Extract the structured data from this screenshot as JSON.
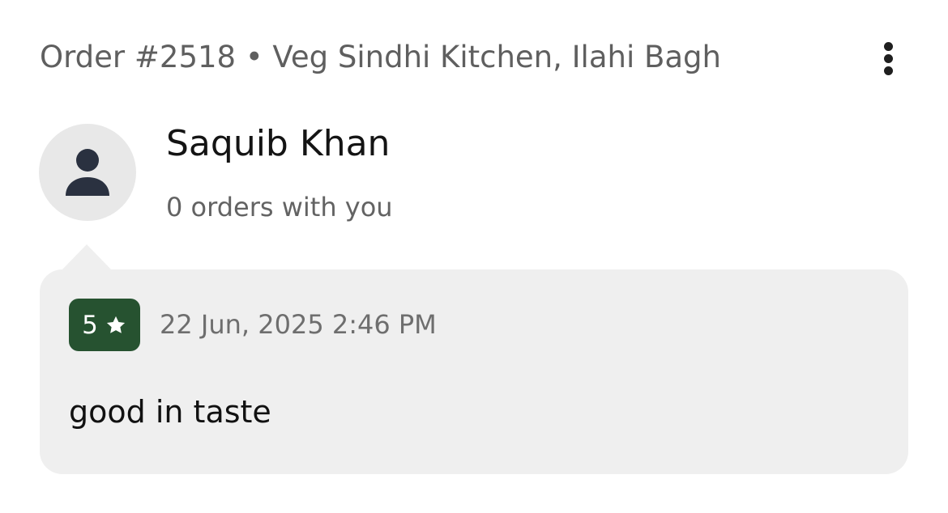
{
  "header": {
    "title": "Order #2518 • Veg Sindhi Kitchen, Ilahi Bagh",
    "more_icon": "more-vertical-icon"
  },
  "customer": {
    "name": "Saquib Khan",
    "order_count_text": "0 orders with you",
    "avatar_icon": "user-icon"
  },
  "review": {
    "rating": "5",
    "rating_icon": "star-icon",
    "date": "22 Jun, 2025 2:46 PM",
    "text": "good in taste"
  },
  "colors": {
    "rating_badge": "#265230",
    "card_background": "#efefef",
    "avatar_background": "#e8e8e8",
    "avatar_glyph": "#2a3140"
  }
}
